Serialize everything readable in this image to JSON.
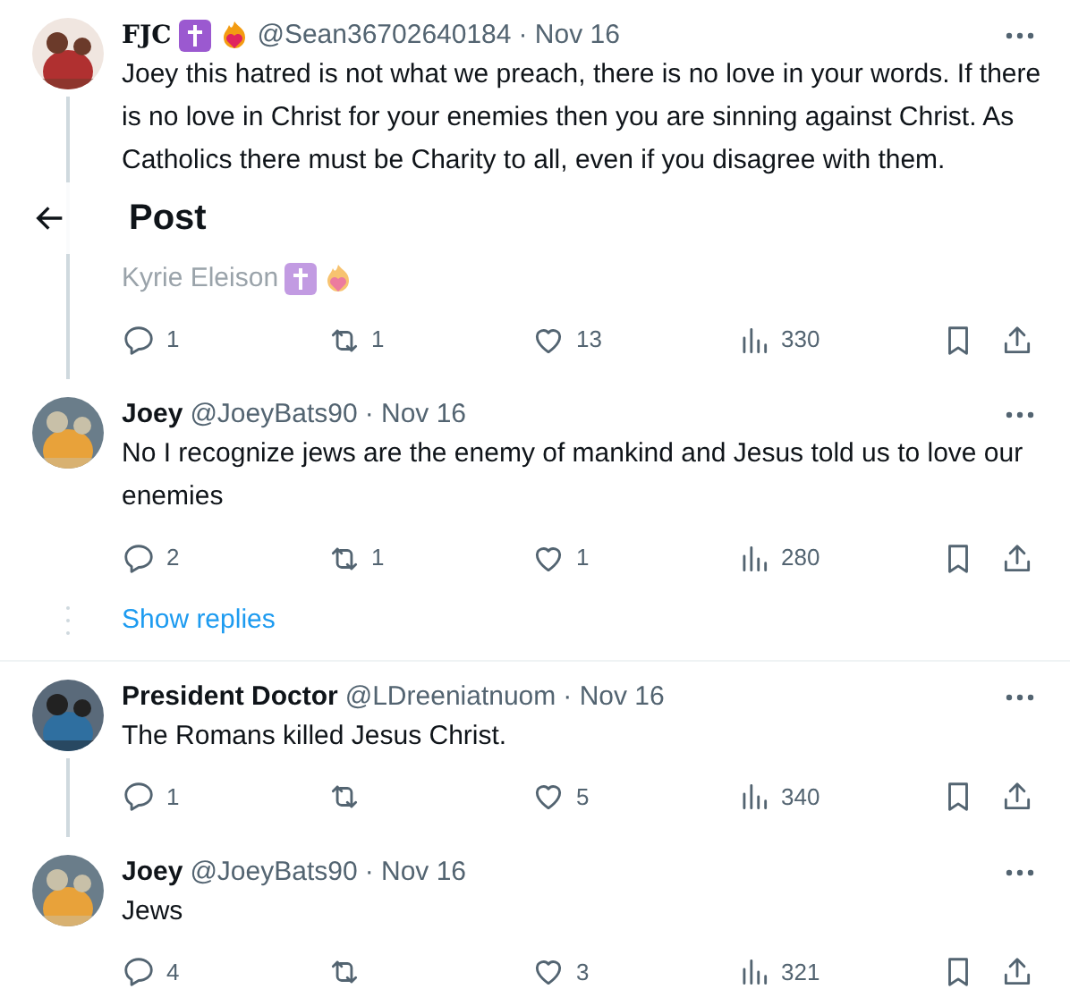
{
  "header": {
    "title": "Post"
  },
  "tweets": [
    {
      "name": "FJC",
      "handle": "@Sean36702640184",
      "date": "· Nov 16",
      "paragraphs": [
        "Joey this hatred is not what we preach, there is no love in your words. If there is no love in Christ for your enemies then you are sinning against Christ. As Catholics there must be Charity to all, even if you disagree with them.",
        "Kyrie Eleison"
      ],
      "replies": "1",
      "reposts": "1",
      "likes": "13",
      "views": "330"
    },
    {
      "name": "Joey",
      "handle": "@JoeyBats90",
      "date": "· Nov 16",
      "paragraphs": [
        "No I recognize jews are the enemy of mankind and Jesus told us to love our enemies"
      ],
      "replies": "2",
      "reposts": "1",
      "likes": "1",
      "views": "280",
      "show_replies": "Show replies"
    },
    {
      "name": "President Doctor",
      "handle": "@LDreeniatnuom",
      "date": "· Nov 16",
      "paragraphs": [
        "The Romans killed Jesus Christ."
      ],
      "replies": "1",
      "likes": "5",
      "views": "340"
    },
    {
      "name": "Joey",
      "handle": "@JoeyBats90",
      "date": "· Nov 16",
      "paragraphs": [
        "Jews"
      ],
      "replies": "4",
      "likes": "3",
      "views": "321"
    }
  ]
}
